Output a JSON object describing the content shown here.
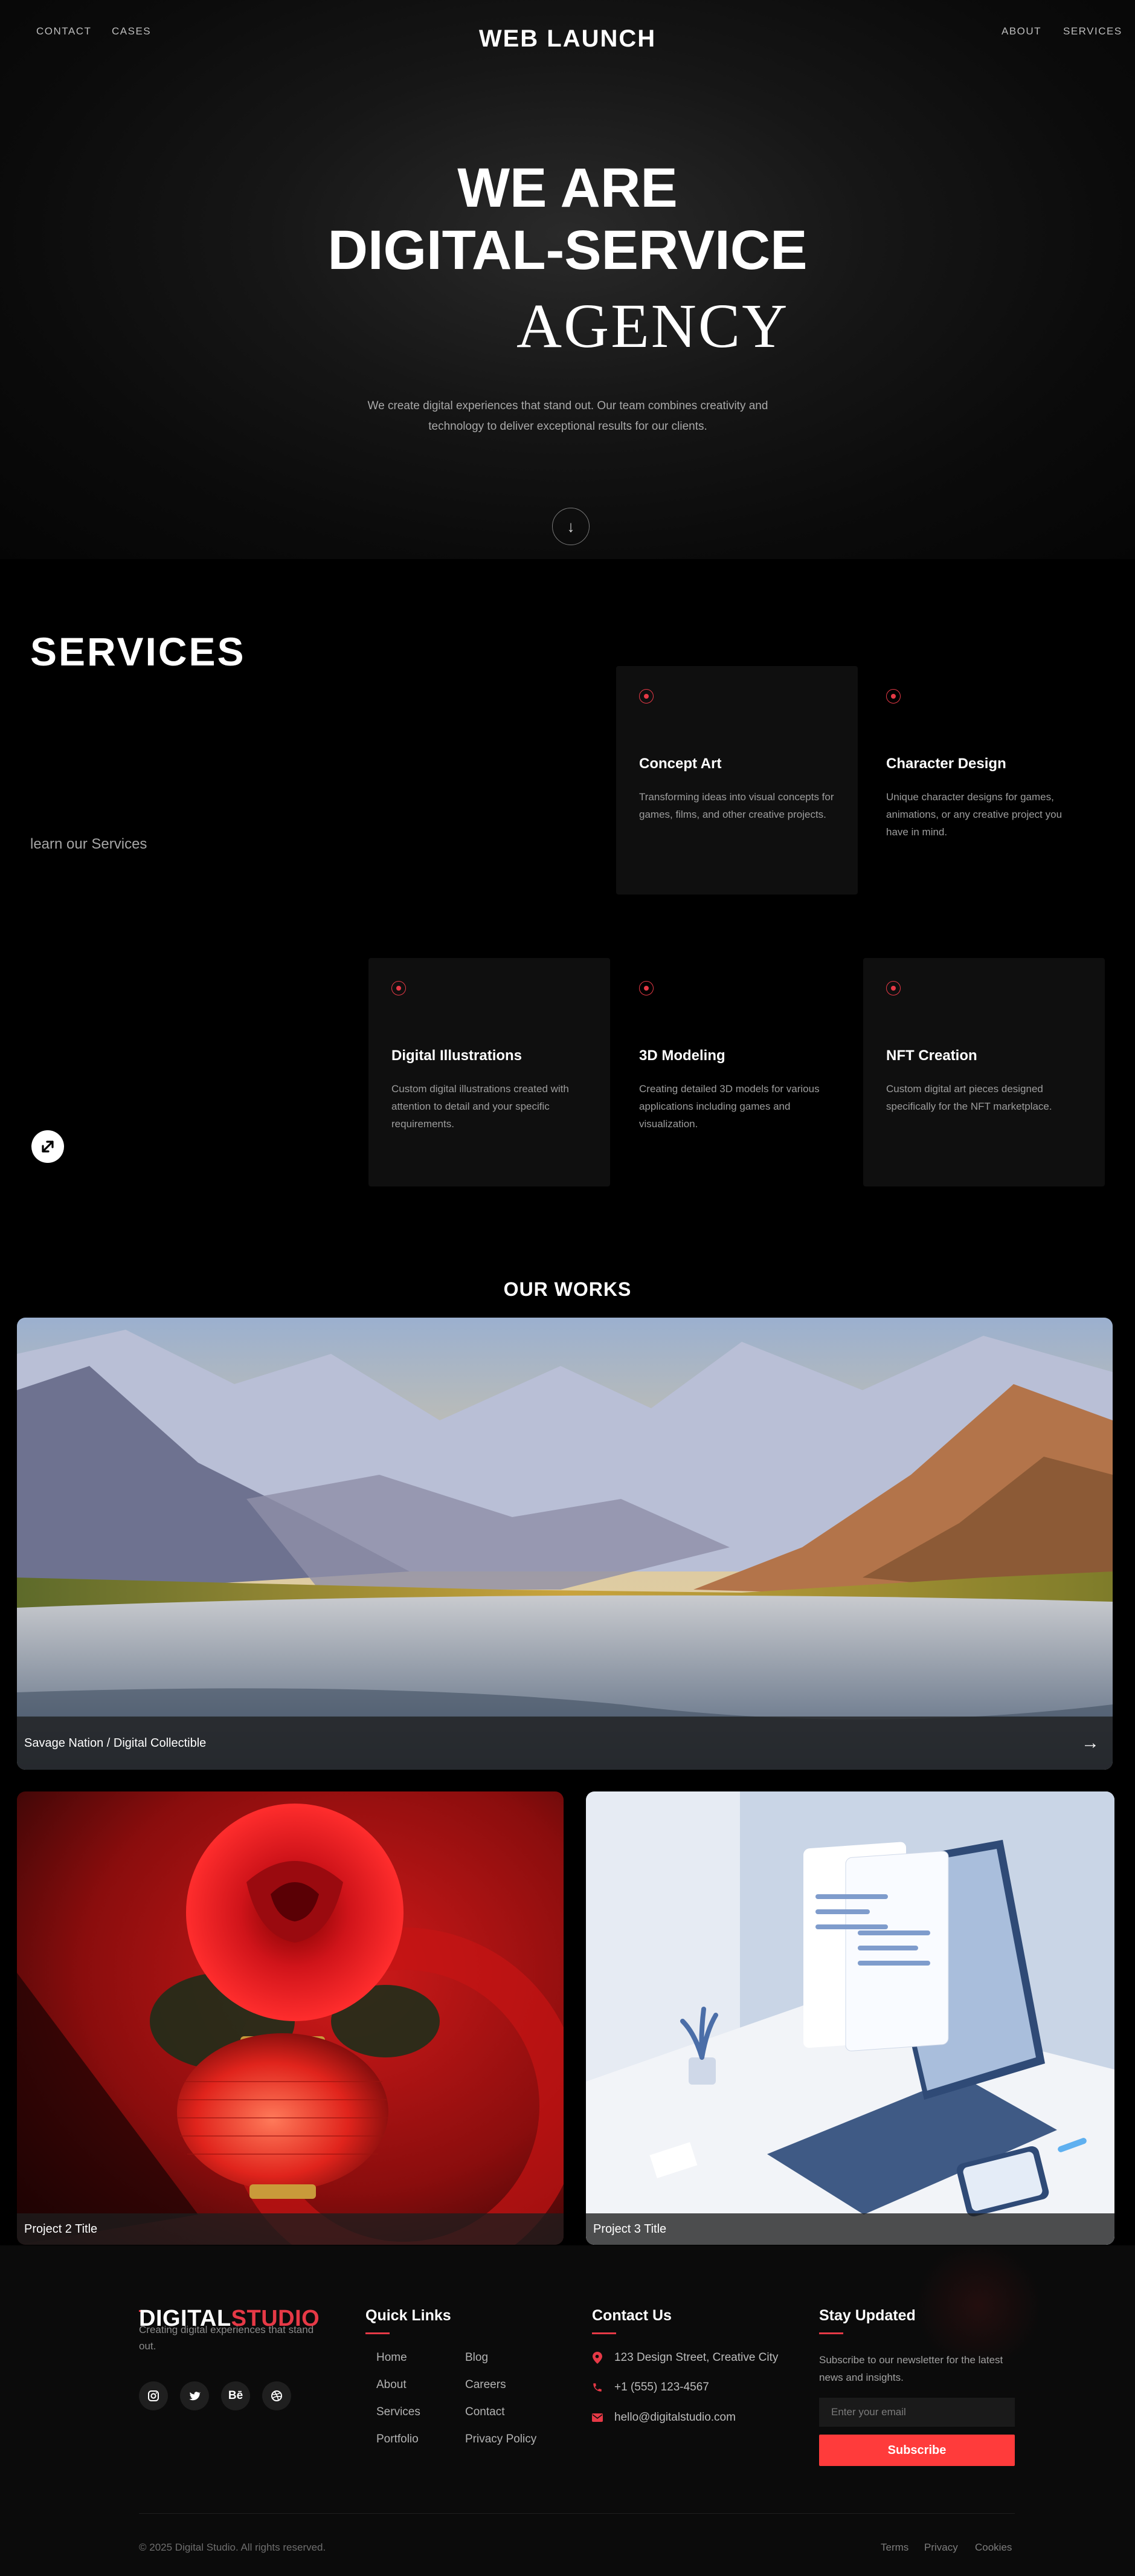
{
  "nav": {
    "brand": "WEB LAUNCH",
    "left_links": [
      "CONTACT",
      "CASES"
    ],
    "right_links": [
      "ABOUT",
      "SERVICES"
    ]
  },
  "hero": {
    "line1": "WE ARE",
    "line2": "DIGITAL-SERVICE",
    "line3": "AGENCY",
    "description": "We create digital experiences that stand out. Our team combines creativity and technology to deliver exceptional results for our clients.",
    "scroll_icon": "arrow-down-icon"
  },
  "services": {
    "title": "SERVICES",
    "subtitle": "learn our Services",
    "expand_icon": "expand-arrows-icon",
    "accent_color": "#e63946",
    "items": [
      {
        "title": "Concept Art",
        "description": "Transforming ideas into visual concepts for games, films, and other creative projects."
      },
      {
        "title": "Character Design",
        "description": "Unique character designs for games, animations, or any creative project you have in mind."
      },
      {
        "title": "Digital Illustrations",
        "description": "Custom digital illustrations created with attention to detail and your specific requirements."
      },
      {
        "title": "3D Modeling",
        "description": "Creating detailed 3D models for various applications including games and visualization."
      },
      {
        "title": "NFT Creation",
        "description": "Custom digital art pieces designed specifically for the NFT marketplace."
      }
    ]
  },
  "works": {
    "title": "OUR WORKS",
    "items": [
      {
        "caption": "Savage Nation / Digital Collectible",
        "arrow": "→"
      },
      {
        "caption": "Project 2 Title"
      },
      {
        "caption": "Project 3 Title"
      }
    ]
  },
  "footer": {
    "logo_part1": "DIGITAL",
    "logo_part2": "STUDIO",
    "tagline": "Creating digital experiences that stand out.",
    "social": [
      {
        "icon": "instagram-icon",
        "glyph": ""
      },
      {
        "icon": "twitter-icon",
        "glyph": ""
      },
      {
        "icon": "behance-icon",
        "glyph": "Bē"
      },
      {
        "icon": "dribbble-icon",
        "glyph": ""
      }
    ],
    "quick_links_title": "Quick Links",
    "quick_links": [
      "Home",
      "Blog",
      "About",
      "Careers",
      "Services",
      "Contact",
      "Portfolio",
      "Privacy Policy"
    ],
    "contact_title": "Contact Us",
    "contact": [
      {
        "icon": "map-pin-icon",
        "text": "123 Design Street, Creative City"
      },
      {
        "icon": "phone-icon",
        "text": "+1 (555) 123-4567"
      },
      {
        "icon": "envelope-icon",
        "text": "hello@digitalstudio.com"
      }
    ],
    "newsletter_title": "Stay Updated",
    "newsletter_desc": "Subscribe to our newsletter for the latest news and insights.",
    "email_placeholder": "Enter your email",
    "subscribe_label": "Subscribe",
    "copyright": "© 2025 Digital Studio. All rights reserved.",
    "legal": [
      "Terms",
      "Privacy",
      "Cookies"
    ]
  }
}
